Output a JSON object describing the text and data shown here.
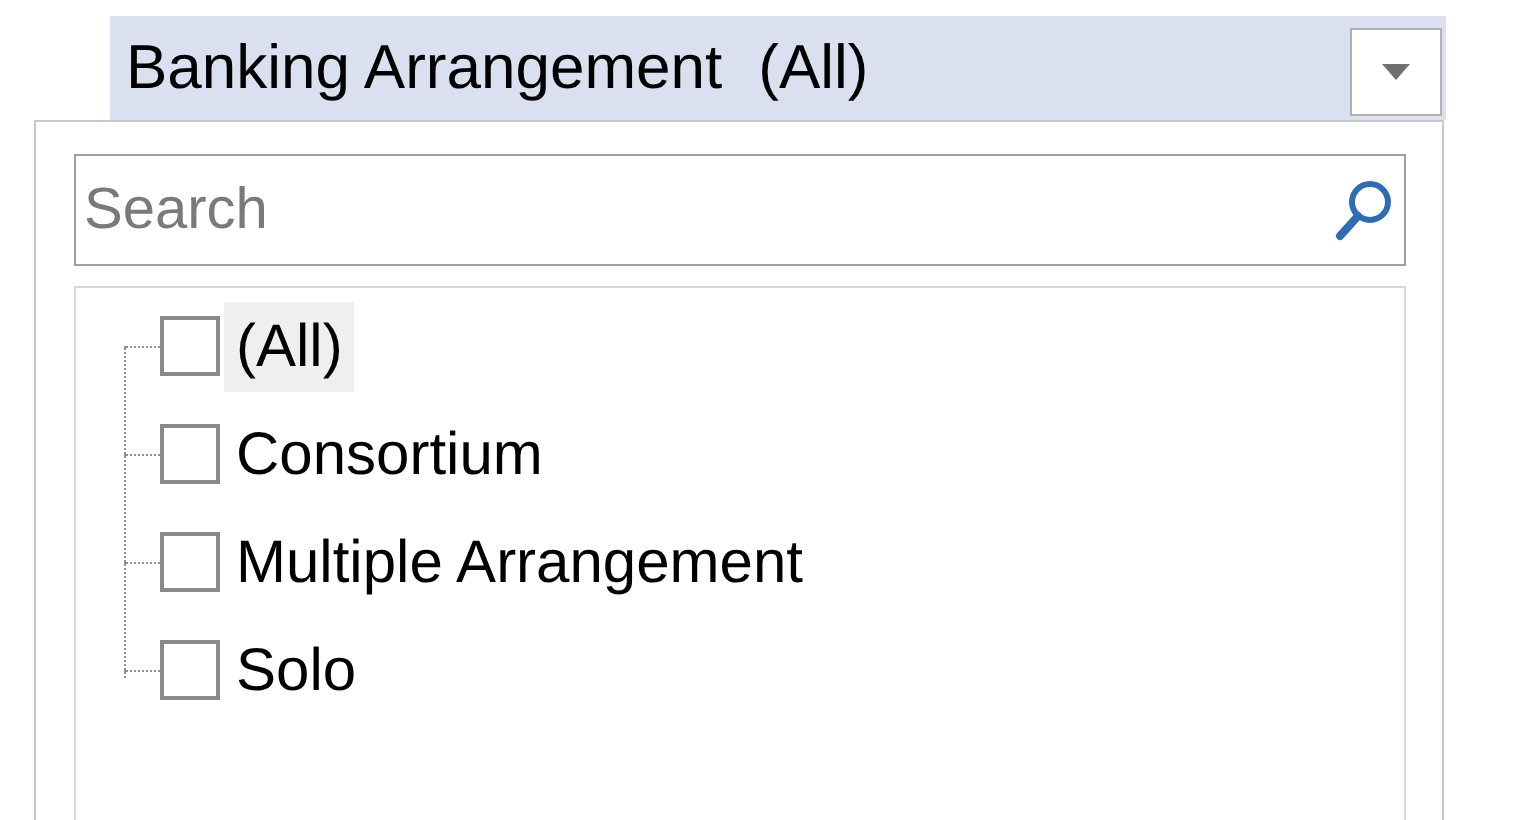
{
  "filter": {
    "field": "Banking Arrangement",
    "value": "(All)"
  },
  "search": {
    "placeholder": "Search"
  },
  "items": [
    {
      "label": "(All)",
      "checked": false,
      "highlighted": true
    },
    {
      "label": "Consortium",
      "checked": false,
      "highlighted": false
    },
    {
      "label": "Multiple Arrangement",
      "checked": false,
      "highlighted": false
    },
    {
      "label": "Solo",
      "checked": false,
      "highlighted": false
    }
  ]
}
